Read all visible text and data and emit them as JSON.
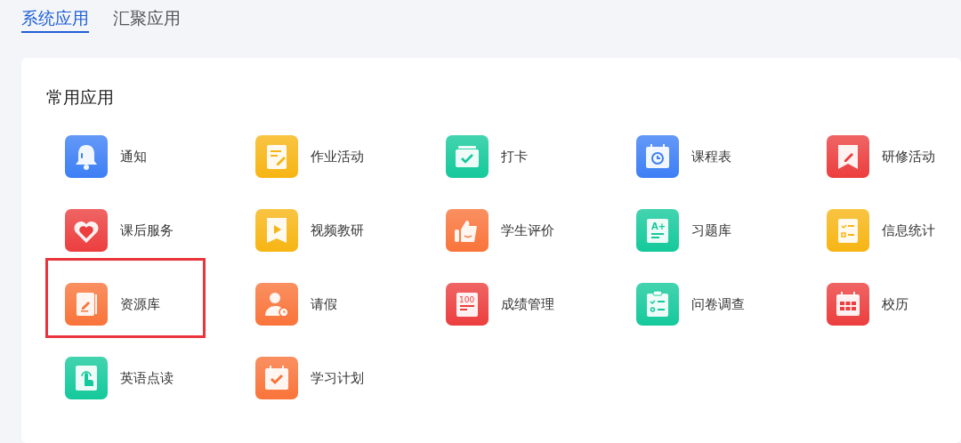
{
  "tabs": [
    {
      "label": "系统应用",
      "selected": true
    },
    {
      "label": "汇聚应用",
      "selected": false
    }
  ],
  "section": {
    "title": "常用应用",
    "apps": [
      {
        "label": "通知",
        "kind": "bell",
        "color": "#3d7ff5",
        "highlighted": false
      },
      {
        "label": "作业活动",
        "kind": "note",
        "color": "#f7b514",
        "highlighted": false
      },
      {
        "label": "打卡",
        "kind": "check",
        "color": "#14c99b",
        "highlighted": false
      },
      {
        "label": "课程表",
        "kind": "schedule",
        "color": "#3d7ff5",
        "highlighted": false
      },
      {
        "label": "研修活动",
        "kind": "bookmark",
        "color": "#ec3e3e",
        "highlighted": false
      },
      {
        "label": "课后服务",
        "kind": "heart",
        "color": "#ec3e3e",
        "highlighted": false
      },
      {
        "label": "视频教研",
        "kind": "video",
        "color": "#f7b514",
        "highlighted": false
      },
      {
        "label": "学生评价",
        "kind": "thumb",
        "color": "#f9743a",
        "highlighted": false
      },
      {
        "label": "习题库",
        "kind": "scroll",
        "color": "#14c99b",
        "icon_text": "A+",
        "highlighted": false
      },
      {
        "label": "信息统计",
        "kind": "list",
        "color": "#f7b514",
        "highlighted": false
      },
      {
        "label": "资源库",
        "kind": "book",
        "color": "#f9743a",
        "highlighted": true
      },
      {
        "label": "请假",
        "kind": "person",
        "color": "#f9743a",
        "highlighted": false
      },
      {
        "label": "成绩管理",
        "kind": "score",
        "color": "#ec3e3e",
        "icon_text": "100",
        "highlighted": false
      },
      {
        "label": "问卷调查",
        "kind": "clipboard",
        "color": "#14c99b",
        "highlighted": false
      },
      {
        "label": "校历",
        "kind": "calendar",
        "color": "#ec3e3e",
        "highlighted": false
      },
      {
        "label": "英语点读",
        "kind": "touch",
        "color": "#14c99b",
        "highlighted": false
      },
      {
        "label": "学习计划",
        "kind": "plan",
        "color": "#f9743a",
        "highlighted": false
      }
    ]
  }
}
